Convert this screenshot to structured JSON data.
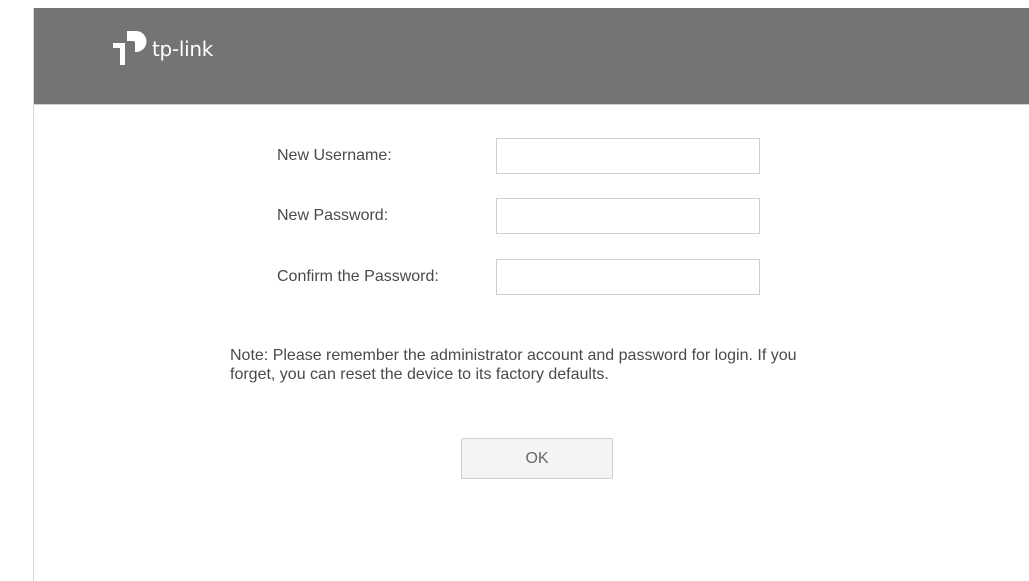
{
  "brand": {
    "logo_text": "tp-link",
    "logo_icon": "tp-link-logo-icon",
    "header_color": "#747474"
  },
  "form": {
    "username": {
      "label": "New Username:",
      "value": "",
      "placeholder": ""
    },
    "password": {
      "label": "New Password:",
      "value": "",
      "placeholder": ""
    },
    "confirm_password": {
      "label": "Confirm the Password:",
      "value": "",
      "placeholder": ""
    }
  },
  "note": "Note: Please remember the administrator account and password for login. If you forget, you can reset the device to its factory defaults.",
  "actions": {
    "ok_label": "OK"
  }
}
